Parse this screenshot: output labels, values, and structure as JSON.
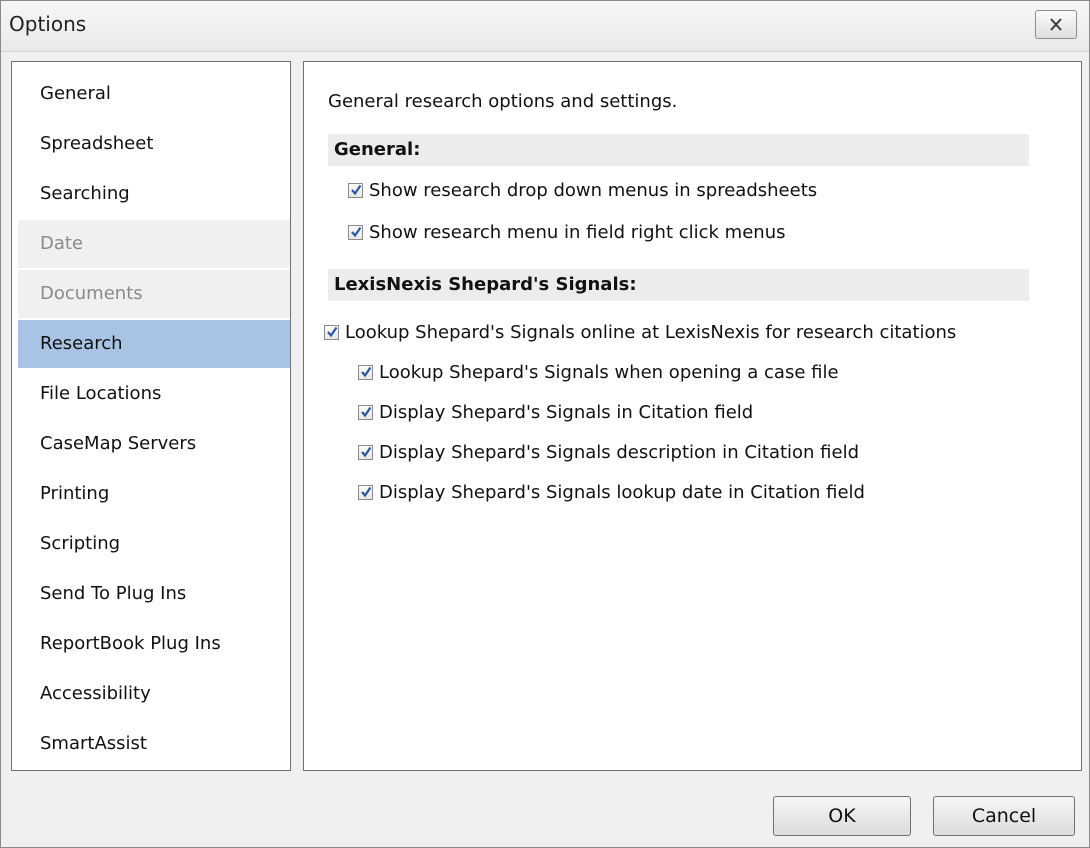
{
  "window": {
    "title": "Options"
  },
  "sidebar": {
    "items": [
      {
        "label": "General",
        "state": "normal"
      },
      {
        "label": "Spreadsheet",
        "state": "normal"
      },
      {
        "label": "Searching",
        "state": "normal"
      },
      {
        "label": "Date",
        "state": "disabled"
      },
      {
        "label": "Documents",
        "state": "disabled"
      },
      {
        "label": "Research",
        "state": "selected"
      },
      {
        "label": "File Locations",
        "state": "normal"
      },
      {
        "label": "CaseMap Servers",
        "state": "normal"
      },
      {
        "label": "Printing",
        "state": "normal"
      },
      {
        "label": "Scripting",
        "state": "normal"
      },
      {
        "label": "Send To Plug Ins",
        "state": "normal"
      },
      {
        "label": "ReportBook Plug Ins",
        "state": "normal"
      },
      {
        "label": "Accessibility",
        "state": "normal"
      },
      {
        "label": "SmartAssist",
        "state": "normal"
      }
    ]
  },
  "panel": {
    "description": "General research options and settings.",
    "general": {
      "heading": "General:",
      "options": [
        {
          "label": "Show research drop down menus in spreadsheets",
          "checked": true
        },
        {
          "label": "Show research menu in field right click menus",
          "checked": true
        }
      ]
    },
    "shepards": {
      "heading": "LexisNexis Shepard's Signals:",
      "main_option": {
        "label": "Lookup Shepard's Signals online at LexisNexis for research citations",
        "checked": true
      },
      "sub_options": [
        {
          "label": "Lookup Shepard's Signals when opening a case file",
          "checked": true
        },
        {
          "label": "Display Shepard's Signals in Citation field",
          "checked": true
        },
        {
          "label": "Display Shepard's Signals description in Citation field",
          "checked": true
        },
        {
          "label": "Display Shepard's Signals lookup date in Citation field",
          "checked": true
        }
      ]
    }
  },
  "buttons": {
    "ok": "OK",
    "cancel": "Cancel"
  },
  "colors": {
    "selected": "#a9c3e4",
    "check": "#2a56a8"
  }
}
